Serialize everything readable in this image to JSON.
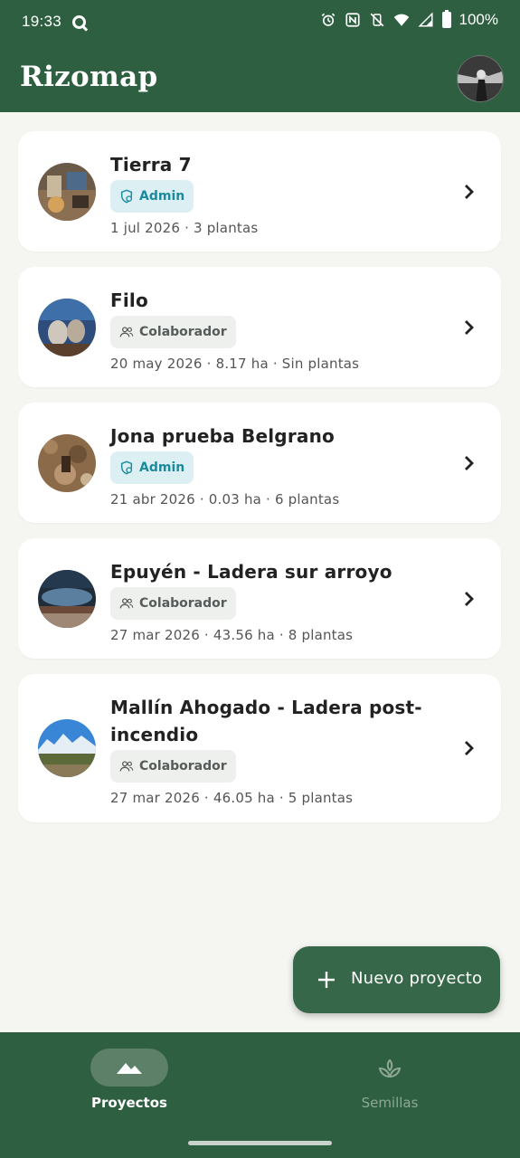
{
  "status_bar": {
    "time": "19:33",
    "battery": "100%",
    "icons": [
      "q-icon",
      "alarm-icon",
      "nfc-icon",
      "vibrate-off-icon",
      "wifi-icon",
      "signal-icon",
      "battery-icon"
    ]
  },
  "app_bar": {
    "title": "Rizomap",
    "avatar_icon": "user-avatar"
  },
  "projects": [
    {
      "title": "Tierra 7",
      "role": "Admin",
      "role_type": "admin",
      "meta": "1 jul 2026  ·  3 plantas"
    },
    {
      "title": "Filo",
      "role": "Colaborador",
      "role_type": "colab",
      "meta": "20 may 2026  · 8.17 ha · Sin plantas"
    },
    {
      "title": "Jona prueba Belgrano",
      "role": "Admin",
      "role_type": "admin",
      "meta": "21 abr 2026  · 0.03 ha · 6 plantas"
    },
    {
      "title": "Epuyén - Ladera sur arroyo",
      "role": "Colaborador",
      "role_type": "colab",
      "meta": "27 mar 2026  · 43.56 ha · 8 plantas"
    },
    {
      "title": "Mallín Ahogado - Ladera post-incendio",
      "role": "Colaborador",
      "role_type": "colab",
      "meta": "27 mar 2026  · 46.05 ha · 5 plantas"
    }
  ],
  "fab": {
    "label": "Nuevo proyecto",
    "icon": "plus-icon"
  },
  "bottom_nav": {
    "items": [
      {
        "label": "Proyectos",
        "icon": "mountains-icon",
        "active": true
      },
      {
        "label": "Semillas",
        "icon": "sprout-icon",
        "active": false
      }
    ]
  },
  "colors": {
    "primary": "#2f5f41",
    "fab": "#356748",
    "admin_badge_bg": "#dcf0f4",
    "admin_badge_text": "#1b8a9c",
    "colab_badge_bg": "#eef0ee",
    "background": "#f5f6f1"
  }
}
